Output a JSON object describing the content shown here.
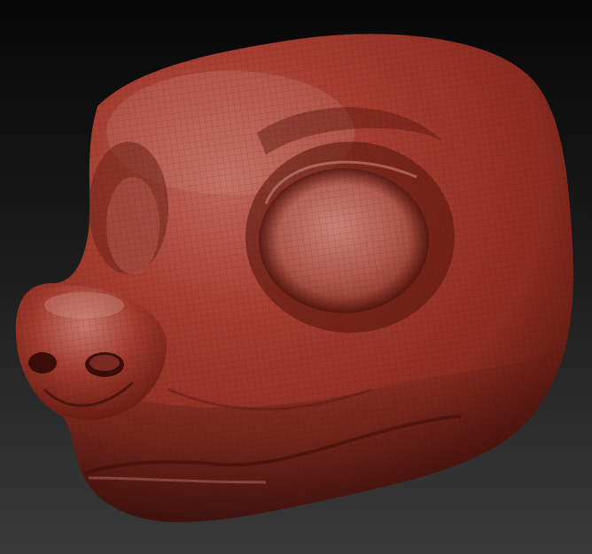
{
  "viewport": {
    "background_top": "#070707",
    "background_bottom": "#3a3a3a"
  },
  "model": {
    "subject": "sculpted-animal-head",
    "material_base": "#a2382c",
    "material_highlight": "#c98178",
    "material_shadow": "#4a120c",
    "wireframe_visible": true
  }
}
